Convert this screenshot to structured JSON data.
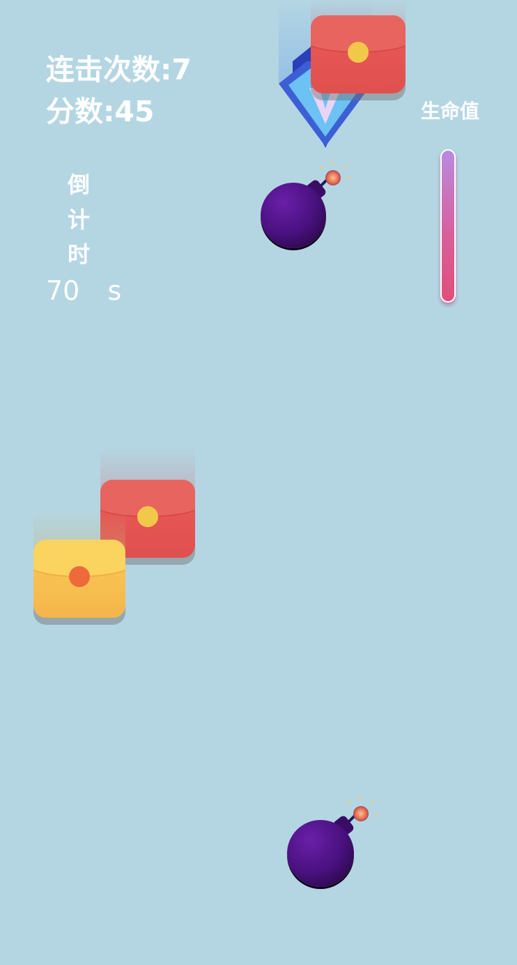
{
  "hud": {
    "combo_text": "连击次数:7",
    "score_text": "分数:45",
    "countdown_label": "倒\n计\n时",
    "countdown_value": "70  s",
    "life_label": "生命值"
  },
  "life": {
    "fraction": 1.0
  },
  "falling_objects": [
    {
      "type": "red-envelope"
    },
    {
      "type": "gem"
    },
    {
      "type": "bomb"
    },
    {
      "type": "red-envelope"
    },
    {
      "type": "yellow-envelope"
    },
    {
      "type": "bomb"
    }
  ],
  "colors": {
    "background": "#b4d6e3",
    "red_envelope": "#e0504e",
    "yellow_envelope": "#f5b54a",
    "bomb": "#4a1180",
    "life_bar_top": "#b98be0",
    "life_bar_bottom": "#e04f78"
  }
}
